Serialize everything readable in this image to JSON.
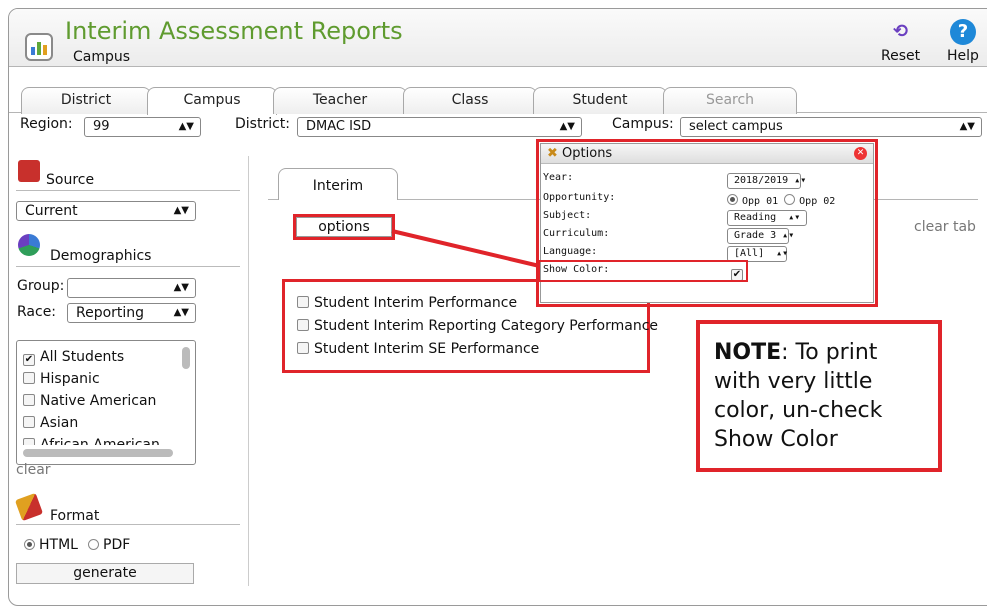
{
  "app": {
    "title": "Interim Assessment Reports",
    "subtitle": "Campus"
  },
  "toolbar": {
    "reset_label": "Reset",
    "help_label": "Help"
  },
  "tabs": [
    "District",
    "Campus",
    "Teacher",
    "Class",
    "Student",
    "Search"
  ],
  "filters": {
    "region_label": "Region:",
    "region_value": "99",
    "district_label": "District:",
    "district_value": "DMAC ISD",
    "campus_label": "Campus:",
    "campus_value": "select campus"
  },
  "sidebar": {
    "source_heading": "Source",
    "source_value": "Current",
    "demographics_heading": "Demographics",
    "group_label": "Group:",
    "group_value": "",
    "race_label": "Race:",
    "race_value": "Reporting",
    "list_items": [
      "All Students",
      "Hispanic",
      "Native American",
      "Asian",
      "African American"
    ],
    "clear_label": "clear",
    "format_heading": "Format",
    "format_html": "HTML",
    "format_pdf": "PDF",
    "generate_label": "generate"
  },
  "main": {
    "tab_label": "Interim",
    "options_label": "options",
    "clear_tab_label": "clear tab",
    "reports": [
      "Student Interim Performance",
      "Student Interim Reporting Category Performance",
      "Student Interim SE Performance"
    ]
  },
  "popup": {
    "title": "Options",
    "year_label": "Year:",
    "year_value": "2018/2019",
    "opportunity_label": "Opportunity:",
    "opp1": "Opp 01",
    "opp2": "Opp 02",
    "subject_label": "Subject:",
    "subject_value": "Reading",
    "curriculum_label": "Curriculum:",
    "curriculum_value": "Grade 3",
    "language_label": "Language:",
    "language_value": "[All]",
    "show_color_label": "Show Color:"
  },
  "note": {
    "bold": "NOTE",
    "text": ": To print with very little color, un-check Show Color"
  },
  "colors": {
    "accent_green": "#5f9b2f",
    "highlight_red": "#e0242a"
  }
}
